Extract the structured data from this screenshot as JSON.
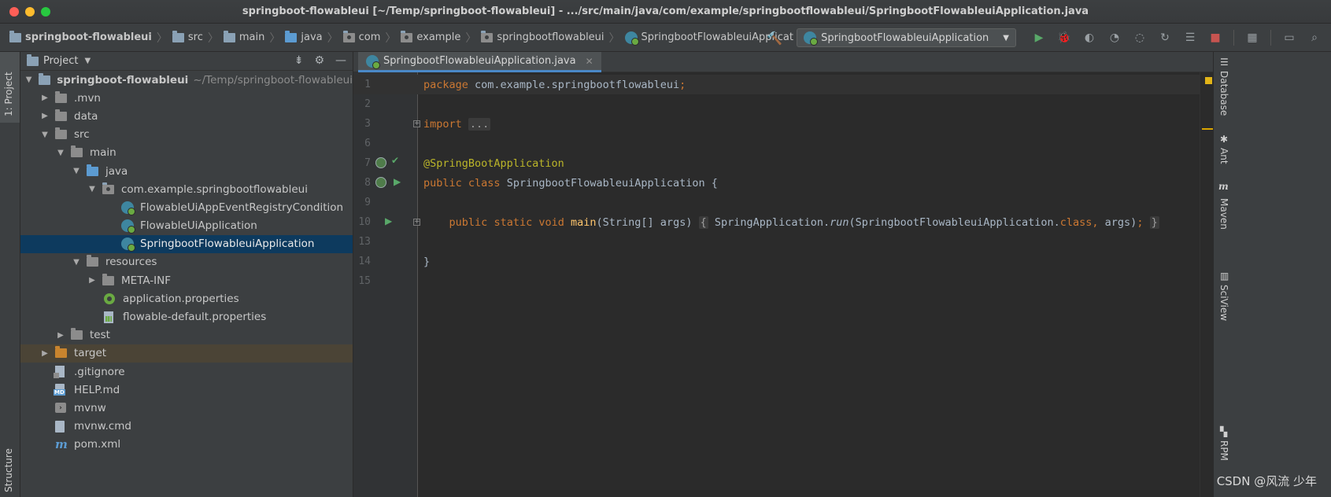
{
  "window": {
    "title": "springboot-flowableui [~/Temp/springboot-flowableui] - .../src/main/java/com/example/springbootflowableui/SpringbootFlowableuiApplication.java"
  },
  "breadcrumbs": [
    "springboot-flowableui",
    "src",
    "main",
    "java",
    "com",
    "example",
    "springbootflowableui",
    "SpringbootFlowableuiApplicat"
  ],
  "toolbar": {
    "run_config": "SpringbootFlowableuiApplication"
  },
  "left_strip": {
    "project_tab": "1: Project",
    "structure_tab": "Structure"
  },
  "project_panel": {
    "title": "Project",
    "tree": [
      {
        "label": "springboot-flowableui",
        "hint": "~/Temp/springboot-flowableui",
        "icon": "module-folder-icon",
        "expanded": true
      },
      {
        "label": ".mvn",
        "icon": "folder-icon",
        "expanded": false
      },
      {
        "label": "data",
        "icon": "folder-icon",
        "expanded": false
      },
      {
        "label": "src",
        "icon": "folder-icon",
        "expanded": true
      },
      {
        "label": "main",
        "icon": "folder-icon",
        "expanded": true
      },
      {
        "label": "java",
        "icon": "source-folder-icon",
        "expanded": true
      },
      {
        "label": "com.example.springbootflowableui",
        "icon": "package-icon",
        "expanded": true
      },
      {
        "label": "FlowableUiAppEventRegistryCondition",
        "icon": "class-icon"
      },
      {
        "label": "FlowableUiApplication",
        "icon": "class-icon"
      },
      {
        "label": "SpringbootFlowableuiApplication",
        "icon": "spring-boot-class-icon",
        "selected": true
      },
      {
        "label": "resources",
        "icon": "resources-folder-icon",
        "expanded": true
      },
      {
        "label": "META-INF",
        "icon": "folder-icon",
        "expanded": false
      },
      {
        "label": "application.properties",
        "icon": "spring-properties-icon"
      },
      {
        "label": "flowable-default.properties",
        "icon": "properties-file-icon"
      },
      {
        "label": "test",
        "icon": "folder-icon",
        "expanded": false
      },
      {
        "label": "target",
        "icon": "excluded-folder-icon",
        "expanded": false
      },
      {
        "label": ".gitignore",
        "icon": "gitignore-file-icon"
      },
      {
        "label": "HELP.md",
        "icon": "markdown-file-icon"
      },
      {
        "label": "mvnw",
        "icon": "shell-script-icon"
      },
      {
        "label": "mvnw.cmd",
        "icon": "text-file-icon"
      },
      {
        "label": "pom.xml",
        "icon": "maven-pom-icon"
      }
    ]
  },
  "editor": {
    "tab_label": "SpringbootFlowableuiApplication.java",
    "lines": [
      {
        "n": "1"
      },
      {
        "n": "2"
      },
      {
        "n": "3"
      },
      {
        "n": "6"
      },
      {
        "n": "7"
      },
      {
        "n": "8"
      },
      {
        "n": "9"
      },
      {
        "n": "10"
      },
      {
        "n": "13"
      },
      {
        "n": "14"
      },
      {
        "n": "15"
      }
    ],
    "code": {
      "package_kw": "package",
      "package_name": " com.example.springbootflowableui",
      "semicolon": ";",
      "import_kw": "import",
      "import_fold": "...",
      "annotation": "@SpringBootApplication",
      "public_kw": "public",
      "class_kw": "class",
      "class_decl_rest": " SpringbootFlowableuiApplication {",
      "indent": "    ",
      "static_kw": "static",
      "void_kw": "void",
      "main_fn": "main",
      "main_params": "(String[] args) ",
      "open_brace": "{",
      "spring_app": " SpringApplication.",
      "run_fn": "run",
      "run_args_start": "(SpringbootFlowableuiApplication.",
      "class_kw2": "class",
      "comma": ",",
      "run_args_end": " args)",
      "close_brace": "}",
      "space": " ",
      "end_brace": "}"
    }
  },
  "right_strip": {
    "tabs": [
      "Database",
      "Ant",
      "Maven",
      "SciView",
      "RPM"
    ]
  },
  "watermark": "CSDN @风流 少年"
}
